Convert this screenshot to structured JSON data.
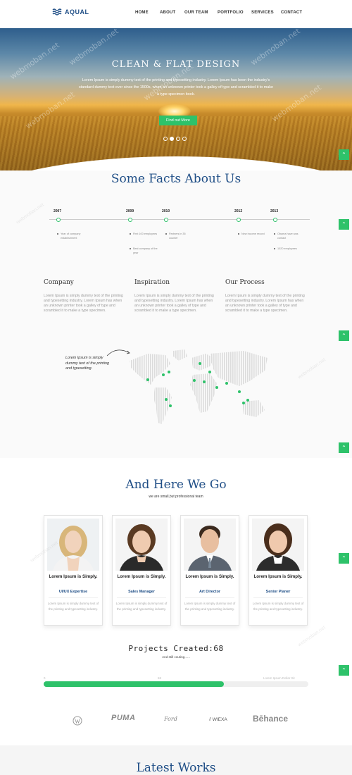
{
  "brand": {
    "name": "AQUAL"
  },
  "nav": {
    "items": [
      "HOME",
      "ABOUT",
      "OUR TEAM",
      "PORTFOLIO",
      "SERVICES",
      "CONTACT"
    ]
  },
  "hero": {
    "title": "CLEAN & FLAT DESIGN",
    "text": "Lorem Ipsum is simply dummy text of the printing and typesetting industry. Lorem Ipsum has been the industry's standard dummy text ever since the 1500s, when an unknown printer took a galley of type and scrambled it to make a type specimen book.",
    "button": "Find out More",
    "slides": 4,
    "active_slide": 2
  },
  "facts": {
    "title": "Some Facts About Us",
    "timeline": [
      {
        "year": "2007",
        "notes": [
          "Year of company establishment"
        ]
      },
      {
        "year": "2009",
        "notes": [
          "First 100 employees",
          "Best company of the year"
        ]
      },
      {
        "year": "2010",
        "notes": [
          "Partners in 35 counter"
        ]
      },
      {
        "year": "2012",
        "notes": [
          "New income record"
        ]
      },
      {
        "year": "2013",
        "notes": [
          "Obama have was contact",
          "1020 employees"
        ]
      }
    ],
    "columns": [
      {
        "title": "Company",
        "text": "Lorem Ipsum is simply dummy text of the printing and typesetting industry. Lorem Ipsum has when an unknown printer took a galley of type and scrambled it to make a type specimen."
      },
      {
        "title": "Inspiration",
        "text": "Lorem Ipsum is simply dummy text of the printing and typesetting industry. Lorem Ipsum has when an unknown printer took a galley of type and scrambled it to make a type specimen."
      },
      {
        "title": "Our Process",
        "text": "Lorem Ipsum is simply dummy text of the printing and typesetting industry. Lorem Ipsum has when an unknown printer took a galley of type and scrambled it to make a type specimen."
      }
    ],
    "map_note": "Lorem Ipsum is simply dummy text of the printing and typesetting."
  },
  "team": {
    "title": "And Here We Go",
    "subtitle": "we are small,but professional team",
    "members": [
      {
        "name": "Lorem Ipsum is Simply.",
        "role": "UI/UX Expertise",
        "text": "Lorem Ipsum is simply dummy text of the printing and typesetting industry."
      },
      {
        "name": "Lorem Ipsum is Simply.",
        "role": "Sales Manager",
        "text": "Lorem Ipsum is simply dummy text of the printing and typesetting industry."
      },
      {
        "name": "Lorem Ipsum is Simply.",
        "role": "Art Director",
        "text": "Lorem Ipsum is simply dummy text of the printing and typesetting industry."
      },
      {
        "name": "Lorem Ipsum is Simply.",
        "role": "Senior Planer",
        "text": "Lorem Ipsum is simply dummy text of the printing and typesetting industry."
      }
    ]
  },
  "projects": {
    "title": "Projects Created:68",
    "subtitle": "And still couting......",
    "progress_left": "0",
    "progress_mid": "68",
    "progress_right": "Lorem Ipsum Dollar Sit",
    "progress_percent": 68
  },
  "brands": [
    "VW",
    "PUMA",
    "Ford",
    "WIEXA",
    "Behance"
  ],
  "latest": {
    "title": "Latest Works"
  },
  "colors": {
    "accent": "#2ec26a",
    "primary": "#1f4e86"
  },
  "icons": {
    "scroll_top": "chevron-up-icon",
    "logo": "waves-icon"
  }
}
